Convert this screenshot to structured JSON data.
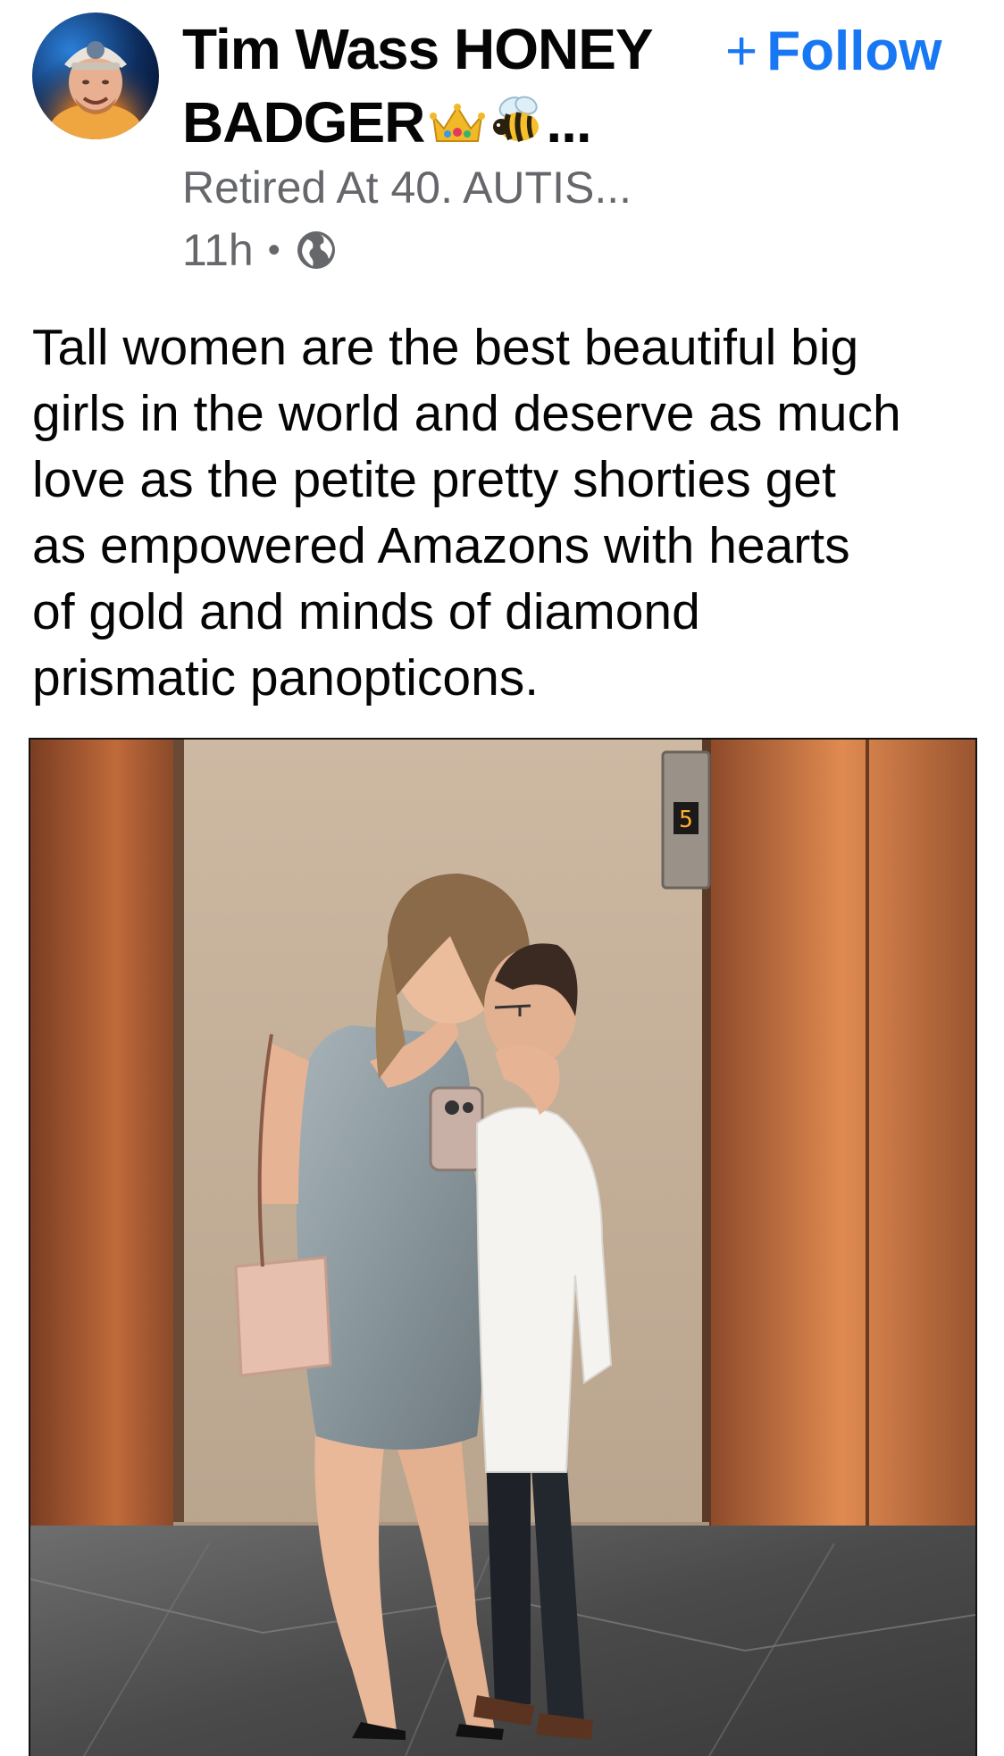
{
  "post": {
    "author": {
      "name": "Tim Wass HONEY BADGER",
      "emoji_crown": "👑",
      "emoji_bee": "🐝",
      "ellipsis": "...",
      "subtitle": "Retired At 40. AUTIS...",
      "avatar_icon": "profile-photo"
    },
    "follow": {
      "plus": "+",
      "label": "Follow"
    },
    "meta": {
      "time": "11h",
      "separator": "•",
      "audience_icon": "globe-icon"
    },
    "text": "Tall women are the best beautiful big\ngirls in the world and deserve as much\nlove as the petite pretty shorties get\nas empowered Amazons with hearts\nof gold and minds of diamond\nprismatic panopticons.",
    "photo": {
      "elevator_floor": "5"
    }
  },
  "colors": {
    "link_blue": "#1877f2",
    "secondary_text": "#65676b",
    "primary_text": "#050505"
  }
}
